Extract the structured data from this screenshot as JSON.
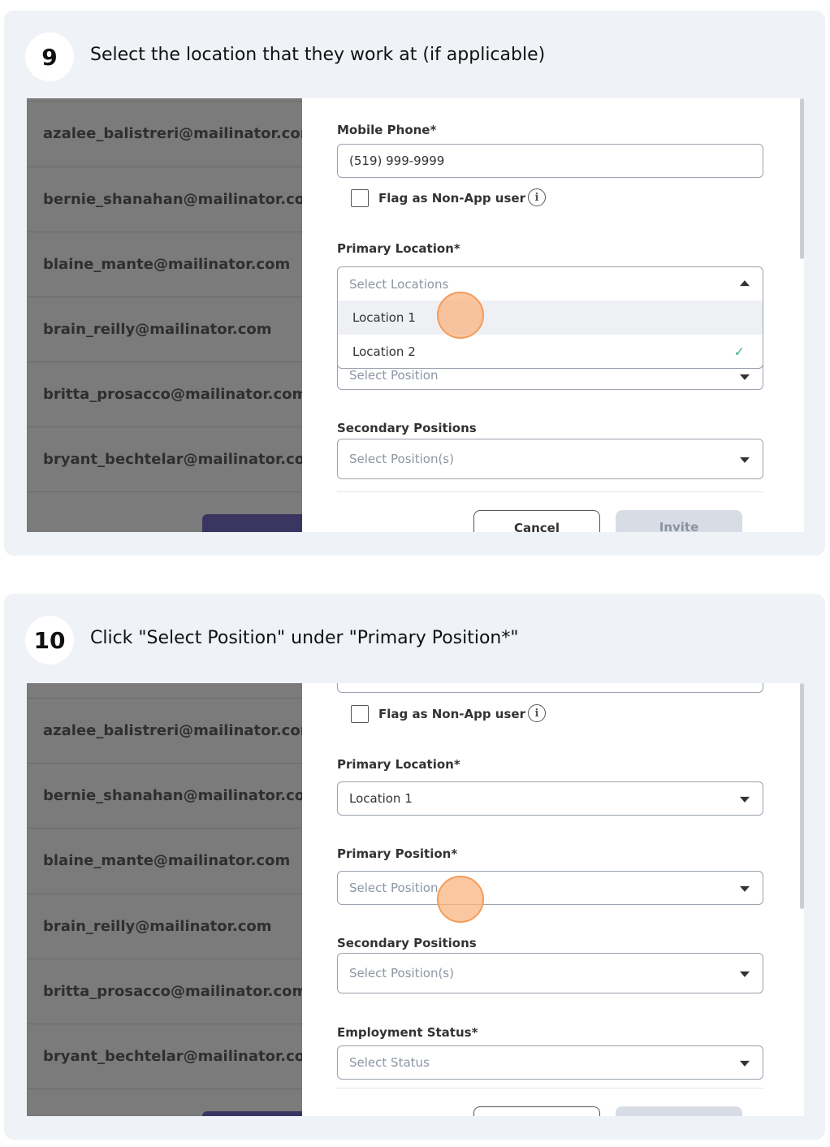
{
  "steps": [
    {
      "number": "9",
      "instruction": "Select the location that they work at (if applicable)",
      "emails": [
        "azalee_balistreri@mailinator.com",
        "bernie_shanahan@mailinator.com",
        "blaine_mante@mailinator.com",
        "brain_reilly@mailinator.com",
        "britta_prosacco@mailinator.com",
        "bryant_bechtelar@mailinator.com"
      ],
      "form": {
        "mobile_phone_label": "Mobile Phone*",
        "mobile_phone_value": "(519) 999-9999",
        "flag_label": "Flag as Non-App user",
        "primary_location_label": "Primary Location*",
        "primary_location_placeholder": "Select Locations",
        "location_options": [
          "Location 1",
          "Location 2"
        ],
        "primary_position_placeholder": "Select Position",
        "secondary_positions_label": "Secondary Positions",
        "secondary_positions_placeholder": "Select Position(s)",
        "cancel_label": "Cancel",
        "invite_label": "Invite"
      }
    },
    {
      "number": "10",
      "instruction": "Click \"Select Position\" under \"Primary Position*\"",
      "emails": [
        "azalee_balistreri@mailinator.com",
        "bernie_shanahan@mailinator.com",
        "blaine_mante@mailinator.com",
        "brain_reilly@mailinator.com",
        "britta_prosacco@mailinator.com",
        "bryant_bechtelar@mailinator.com"
      ],
      "form": {
        "flag_label": "Flag as Non-App user",
        "primary_location_label": "Primary Location*",
        "primary_location_value": "Location 1",
        "primary_position_label": "Primary Position*",
        "primary_position_placeholder": "Select Position",
        "secondary_positions_label": "Secondary Positions",
        "secondary_positions_placeholder": "Select Position(s)",
        "employment_status_label": "Employment Status*",
        "employment_status_placeholder": "Select Status"
      }
    }
  ],
  "colors": {
    "card_bg": "#eff2f7",
    "overlay_gray": "#7b7b7b",
    "click_marker": "#f39c5a",
    "check_green": "#3bb28a"
  },
  "icons": {
    "checkmark": "✓",
    "info": "i"
  }
}
